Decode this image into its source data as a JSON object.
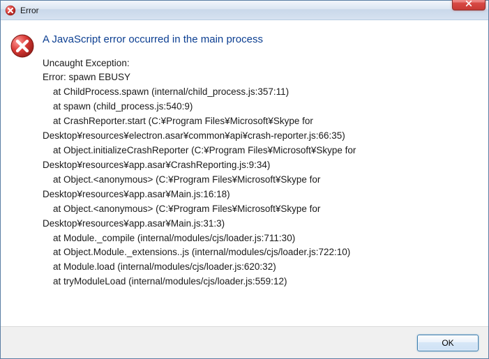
{
  "titlebar": {
    "title": "Error",
    "close_glyph": "×"
  },
  "dialog": {
    "heading": "A JavaScript error occurred in the main process",
    "trace": "Uncaught Exception:\nError: spawn EBUSY\n    at ChildProcess.spawn (internal/child_process.js:357:11)\n    at spawn (child_process.js:540:9)\n    at CrashReporter.start (C:¥Program Files¥Microsoft¥Skype for Desktop¥resources¥electron.asar¥common¥api¥crash-reporter.js:66:35)\n    at Object.initializeCrashReporter (C:¥Program Files¥Microsoft¥Skype for Desktop¥resources¥app.asar¥CrashReporting.js:9:34)\n    at Object.<anonymous> (C:¥Program Files¥Microsoft¥Skype for Desktop¥resources¥app.asar¥Main.js:16:18)\n    at Object.<anonymous> (C:¥Program Files¥Microsoft¥Skype for Desktop¥resources¥app.asar¥Main.js:31:3)\n    at Module._compile (internal/modules/cjs/loader.js:711:30)\n    at Object.Module._extensions..js (internal/modules/cjs/loader.js:722:10)\n    at Module.load (internal/modules/cjs/loader.js:620:32)\n    at tryModuleLoad (internal/modules/cjs/loader.js:559:12)"
  },
  "footer": {
    "ok_label": "OK"
  },
  "colors": {
    "heading": "#0b3e91",
    "error_red": "#d03438"
  }
}
